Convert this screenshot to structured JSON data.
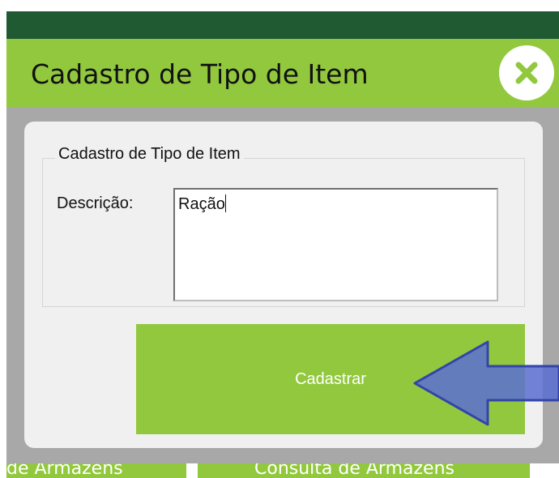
{
  "window": {
    "title": "Cadastro de Tipo de Item",
    "close_icon": "close-x-icon"
  },
  "form": {
    "group_title": "Cadastro de Tipo de Item",
    "description_label": "Descrição:",
    "description_value": "Ração",
    "submit_label": "Cadastrar"
  },
  "background": {
    "left_button_text": "de Armazens",
    "right_button_text": "Consulta de Armazens"
  },
  "colors": {
    "accent_green": "#92c83e",
    "dark_green": "#1f5a33",
    "arrow_blue": "#5a6fd1"
  }
}
